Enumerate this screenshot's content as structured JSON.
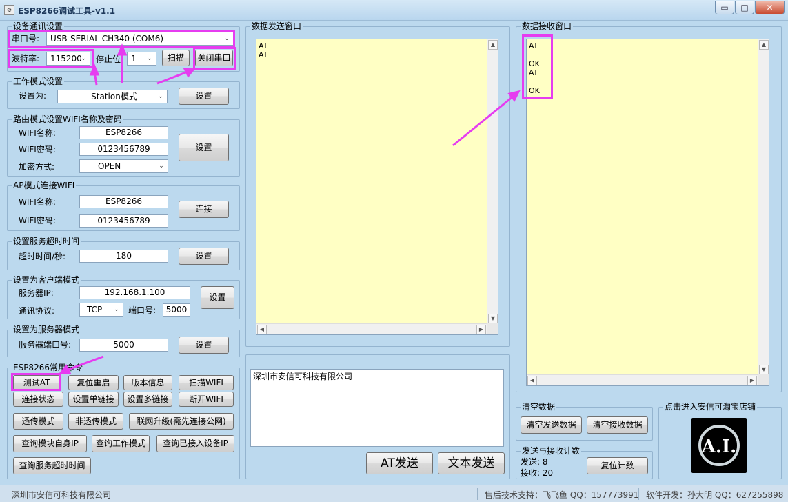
{
  "window": {
    "title": "ESP8266调试工具-v1.1",
    "minimize": "▭",
    "maximize": "□",
    "close": "✕"
  },
  "comm": {
    "legend": "设备通讯设置",
    "port_label": "串口号:",
    "port_value": "USB-SERIAL CH340 (COM6)",
    "baud_label": "波特率:",
    "baud_value": "115200",
    "stopbit_label": "停止位",
    "stopbit_value": "1",
    "scan_button": "扫描",
    "close_button": "关闭串口"
  },
  "mode": {
    "legend": "工作模式设置",
    "set_label": "设置为:",
    "mode_value": "Station模式",
    "set_button": "设置"
  },
  "router": {
    "legend": "路由模式设置WIFI名称及密码",
    "name_label": "WIFI名称:",
    "name_value": "ESP8266",
    "pwd_label": "WIFI密码:",
    "pwd_value": "0123456789",
    "enc_label": "加密方式:",
    "enc_value": "OPEN",
    "set_button": "设置"
  },
  "ap": {
    "legend": "AP模式连接WIFI",
    "name_label": "WIFI名称:",
    "name_value": "ESP8266",
    "pwd_label": "WIFI密码:",
    "pwd_value": "0123456789",
    "connect_button": "连接"
  },
  "timeout": {
    "legend": "设置服务超时时间",
    "label": "超时时间/秒:",
    "value": "180",
    "set_button": "设置"
  },
  "client": {
    "legend": "设置为客户端模式",
    "ip_label": "服务器IP:",
    "ip_value": "192.168.1.100",
    "proto_label": "通讯协议:",
    "proto_value": "TCP",
    "port_label": "端口号:",
    "port_value": "5000",
    "set_button": "设置"
  },
  "server": {
    "legend": "设置为服务器模式",
    "port_label": "服务器端口号:",
    "port_value": "5000",
    "set_button": "设置"
  },
  "commands": {
    "legend": "ESP8266常用命令",
    "b1": "测试AT",
    "b2": "复位重启",
    "b3": "版本信息",
    "b4": "扫描WIFI",
    "b5": "连接状态",
    "b6": "设置单链接",
    "b7": "设置多链接",
    "b8": "断开WIFI",
    "b9": "透传模式",
    "b10": "非透传模式",
    "b11": "联网升级(需先连接公网)",
    "b12": "查询模块自身IP",
    "b13": "查询工作模式",
    "b14": "查询已接入设备IP",
    "b15": "查询服务超时时间"
  },
  "send": {
    "legend": "数据发送窗口",
    "lines": [
      "AT",
      "AT"
    ]
  },
  "receive": {
    "legend": "数据接收窗口",
    "lines": [
      "AT",
      "",
      "OK",
      "AT",
      "",
      "OK"
    ]
  },
  "input": {
    "text": "深圳市安信可科技有限公司",
    "at_send": "AT发送",
    "text_send": "文本发送"
  },
  "clear": {
    "legend": "清空数据",
    "clear_send": "清空发送数据",
    "clear_recv": "清空接收数据"
  },
  "counter": {
    "legend": "发送与接收计数",
    "sent_label": "发送:",
    "sent_value": "8",
    "recv_label": "接收:",
    "recv_value": "20",
    "reset_button": "复位计数"
  },
  "shop": {
    "legend": "点击进入安信可淘宝店铺",
    "logo_text": "A.I."
  },
  "status": {
    "company": "深圳市安信可科技有限公司",
    "support": "售后技术支持：飞飞鱼 QQ：157773991",
    "developer": "软件开发：孙大明 QQ：627255898"
  },
  "colors": {
    "highlight": "#e63cf0",
    "textarea_bg": "#ffffc4",
    "window_bg": "#bcd9ee"
  }
}
